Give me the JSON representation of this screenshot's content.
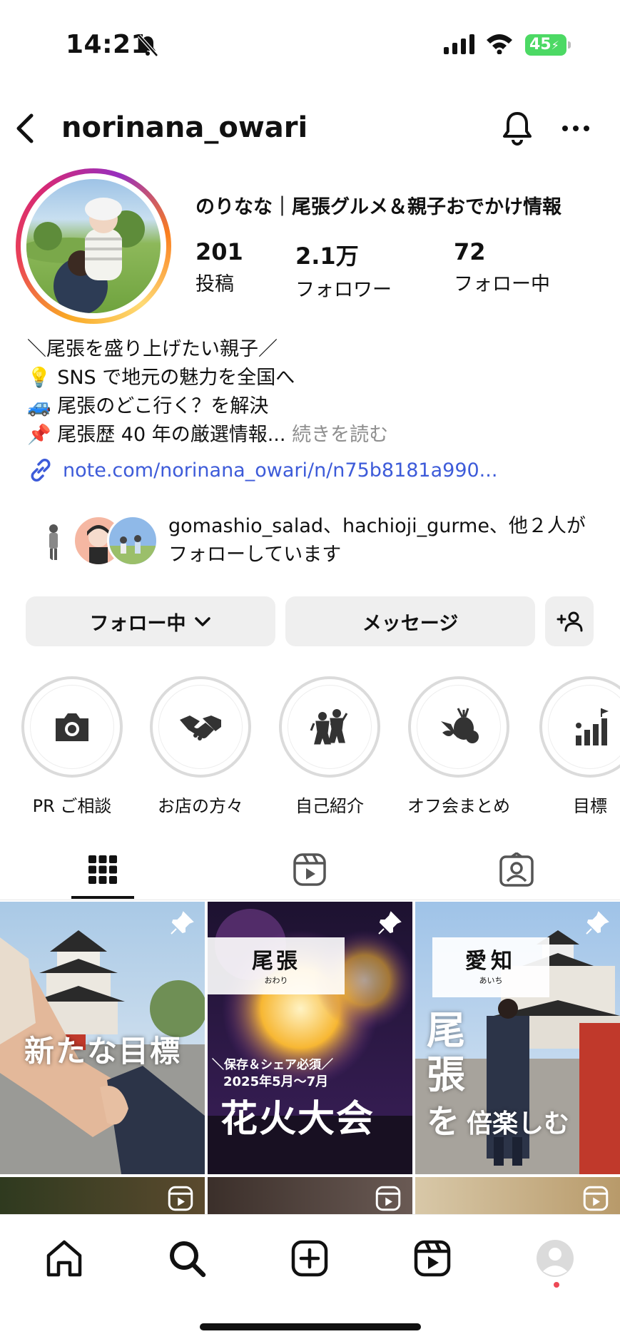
{
  "status_bar": {
    "time": "14:21",
    "battery": "45"
  },
  "header": {
    "username": "norinana_owari"
  },
  "profile": {
    "display_name": "のりなな｜尾張グルメ＆親子おでかけ情報",
    "stats": [
      {
        "value": "201",
        "label": "投稿"
      },
      {
        "value": "2.1万",
        "label": "フォロワー"
      },
      {
        "value": "72",
        "label": "フォロー中"
      }
    ],
    "bio": {
      "line1": "＼尾張を盛り上げたい親子／",
      "line2": "💡 SNS で地元の魅力を全国へ",
      "line3": "🚙 尾張のどこ行く？を解決",
      "line4": "📌 尾張歴 40 年の厳選情報...",
      "more": " 続きを読む"
    },
    "link": "note.com/norinana_owari/n/n75b8181a990...",
    "followed_by": "gomashio_salad、hachioji_gurme、他２人がフォローしています"
  },
  "buttons": {
    "following": "フォロー中",
    "message": "メッセージ"
  },
  "highlights": [
    {
      "label": "PR ご相談",
      "icon": "camera-icon"
    },
    {
      "label": "お店の方々",
      "icon": "handshake-icon"
    },
    {
      "label": "自己紹介",
      "icon": "people-icon"
    },
    {
      "label": "オフ会まとめ",
      "icon": "vegetables-icon"
    },
    {
      "label": "目標",
      "icon": "goal-icon"
    }
  ],
  "tabs": [
    {
      "name": "grid",
      "icon": "grid-icon",
      "active": true
    },
    {
      "name": "reels",
      "icon": "reels-icon",
      "active": false
    },
    {
      "name": "tagged",
      "icon": "tagged-icon",
      "active": false
    }
  ],
  "posts": [
    {
      "overlay": "新たな目標",
      "pinned": true
    },
    {
      "title": "尾張",
      "title_reading": "おわり",
      "subtitle": "＼保存＆シェア必須／",
      "date": "2025年5月〜7月",
      "overlay": "花火大会",
      "pinned": true
    },
    {
      "title": "愛知",
      "title_reading": "あいち",
      "overlay_big": "尾張",
      "overlay_rest": "を",
      "overlay_tail": "倍楽しむ",
      "pinned": true
    }
  ],
  "colors": {
    "accent_link": "#3d5bd9",
    "button_bg": "#efefef",
    "battery": "#4cd964",
    "notif_dot": "#ed4956"
  }
}
